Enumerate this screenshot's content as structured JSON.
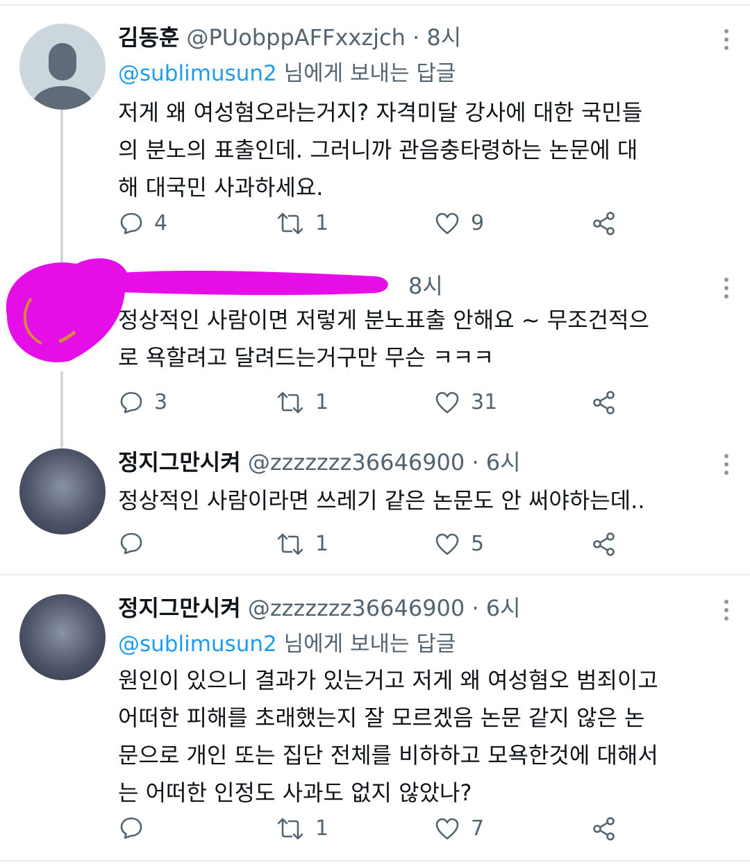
{
  "colors": {
    "accent": "#1d9bf0",
    "text": "#0f1419",
    "muted": "#536471",
    "redaction": "#e60ee6"
  },
  "tweets": [
    {
      "name": "김동훈",
      "handle": "@PUobppAFFxxzjch",
      "sep": "·",
      "time": "8시",
      "reply_mention": "@sublimusun2",
      "reply_suffix": "님에게 보내는 답글",
      "text": "저게 왜 여성혐오라는거지?  자격미달 강사에 대한 국민들\n의 분노의 표출인데.  그러니까 관음충타령하는 논문에 대\n해 대국민 사과하세요.",
      "replies": "4",
      "retweets": "1",
      "likes": "9"
    },
    {
      "time": "8시",
      "text": "정상적인 사람이면 저렇게 분노표출 안해요 ~ 무조건적으\n로 욕할려고 달려드는거구만 무슨 ㅋㅋㅋ",
      "replies": "3",
      "retweets": "1",
      "likes": "31"
    },
    {
      "name": "정지그만시켜",
      "handle": "@zzzzzzz36646900",
      "sep": "·",
      "time": "6시",
      "text": "정상적인 사람이라면 쓰레기 같은 논문도 안 써야하는데..",
      "replies": "",
      "retweets": "1",
      "likes": "5"
    },
    {
      "name": "정지그만시켜",
      "handle": "@zzzzzzz36646900",
      "sep": "·",
      "time": "6시",
      "reply_mention": "@sublimusun2",
      "reply_suffix": "님에게 보내는 답글",
      "text": "원인이 있으니 결과가 있는거고 저게 왜 여성혐오 범죄이고\n어떠한 피해를 초래했는지 잘 모르겠음 논문 같지 않은 논\n문으로 개인 또는 집단 전체를 비하하고 모욕한것에 대해서\n는 어떠한 인정도 사과도 없지 않았나?",
      "replies": "",
      "retweets": "1",
      "likes": "7"
    }
  ]
}
